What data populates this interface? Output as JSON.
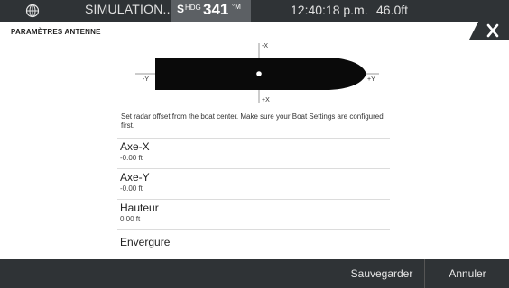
{
  "statusbar": {
    "globe_icon": "globe-icon",
    "mode": "SIMULATION...",
    "heading_prefix": "S",
    "heading_label": "HDG",
    "heading_value": "341",
    "heading_unit": "°M",
    "time": "12:40:18 p.m.",
    "depth": "46.0ft"
  },
  "dialog": {
    "title": "PARAMÈTRES ANTENNE",
    "close_icon": "close-icon"
  },
  "diagram": {
    "axis_minus_x": "-X",
    "axis_plus_x": "+X",
    "axis_minus_y": "-Y",
    "axis_plus_y": "+Y"
  },
  "description": "Set radar offset from the boat center. Make sure your Boat Settings are configured first.",
  "fields": [
    {
      "label": "Axe-X",
      "value": "-0.00 ft"
    },
    {
      "label": "Axe-Y",
      "value": "-0.00 ft"
    },
    {
      "label": "Hauteur",
      "value": "0.00 ft"
    },
    {
      "label": "Envergure",
      "value": ""
    }
  ],
  "buttons": {
    "save": "Sauvegarder",
    "cancel": "Annuler"
  }
}
